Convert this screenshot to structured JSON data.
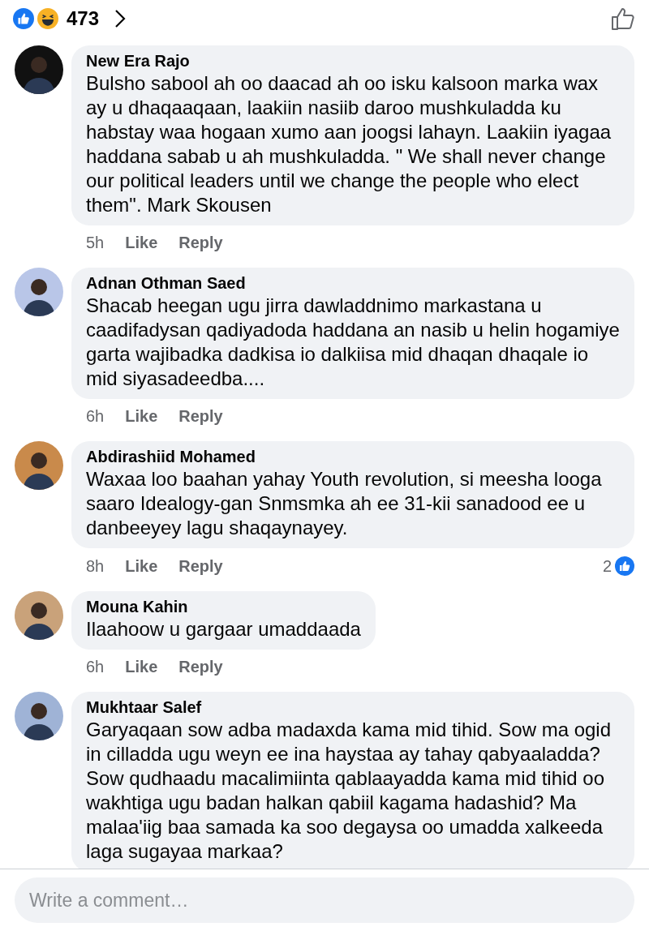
{
  "header": {
    "reaction_count": "473"
  },
  "comments": [
    {
      "author": "New Era Rajo",
      "text": "Bulsho sabool ah oo daacad ah oo isku kalsoon marka wax ay u dhaqaaqaan, laakiin nasiib daroo mushkuladda ku habstay waa hogaan xumo aan joogsi lahayn. Laakiin iyagaa haddana sabab u ah mushkuladda. \" We shall never change our political leaders until we change the people who elect them\". Mark Skousen",
      "time": "5h",
      "like": "Like",
      "reply": "Reply"
    },
    {
      "author": "Adnan Othman Saed",
      "text": "Shacab heegan ugu jirra dawladdnimo markastana u caadifadysan qadiyadoda haddana an nasib u helin hogamiye garta wajibadka dadkisa io dalkiisa mid dhaqan dhaqale io mid siyasadeedba....",
      "time": "6h",
      "like": "Like",
      "reply": "Reply"
    },
    {
      "author": "Abdirashiid Mohamed",
      "text": "Waxaa loo baahan yahay Youth revolution, si meesha looga saaro Idealogy-gan Snmsmka ah ee 31-kii sanadood ee u danbeeyey lagu shaqaynayey.",
      "time": "8h",
      "like": "Like",
      "reply": "Reply",
      "likes": "2"
    },
    {
      "author": "Mouna Kahin",
      "text": "Ilaahoow u gargaar umaddaada",
      "time": "6h",
      "like": "Like",
      "reply": "Reply"
    },
    {
      "author": "Mukhtaar Salef",
      "text": "Garyaqaan sow adba madaxda kama mid tihid. Sow ma ogid in cilladda ugu weyn ee ina haystaa ay tahay qabyaaladda? Sow qudhaadu macalimiinta qablaayadda kama mid tihid oo wakhtiga ugu badan halkan qabiil kagama hadashid? Ma malaa'iig baa samada ka soo degaysa oo umadda xalkeeda laga sugayaa markaa?"
    }
  ],
  "composer": {
    "placeholder": "Write a comment…"
  }
}
